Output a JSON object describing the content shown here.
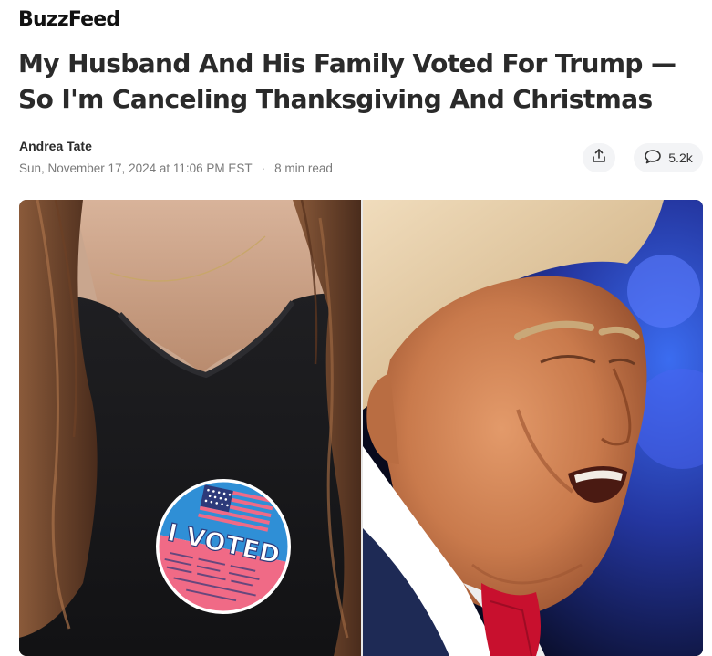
{
  "site": {
    "logo": "BuzzFeed"
  },
  "article": {
    "title": "My Husband And His Family Voted For Trump — So I'm Canceling Thanksgiving And Christmas",
    "author": "Andrea Tate",
    "date": "Sun, November 17, 2024 at 11:06 PM EST",
    "separator": "·",
    "read_time": "8 min read"
  },
  "actions": {
    "share_icon": "share-upload-icon",
    "comment_icon": "speech-bubble-icon",
    "comment_count": "5.2k"
  },
  "hero": {
    "sticker_text": "I VOTED"
  },
  "colors": {
    "sticker_blue": "#2f8fd6",
    "sticker_pink": "#f06a86",
    "sticker_navy": "#2d3a7a",
    "tie_red": "#c8102e",
    "suit_navy": "#1e2a55"
  }
}
